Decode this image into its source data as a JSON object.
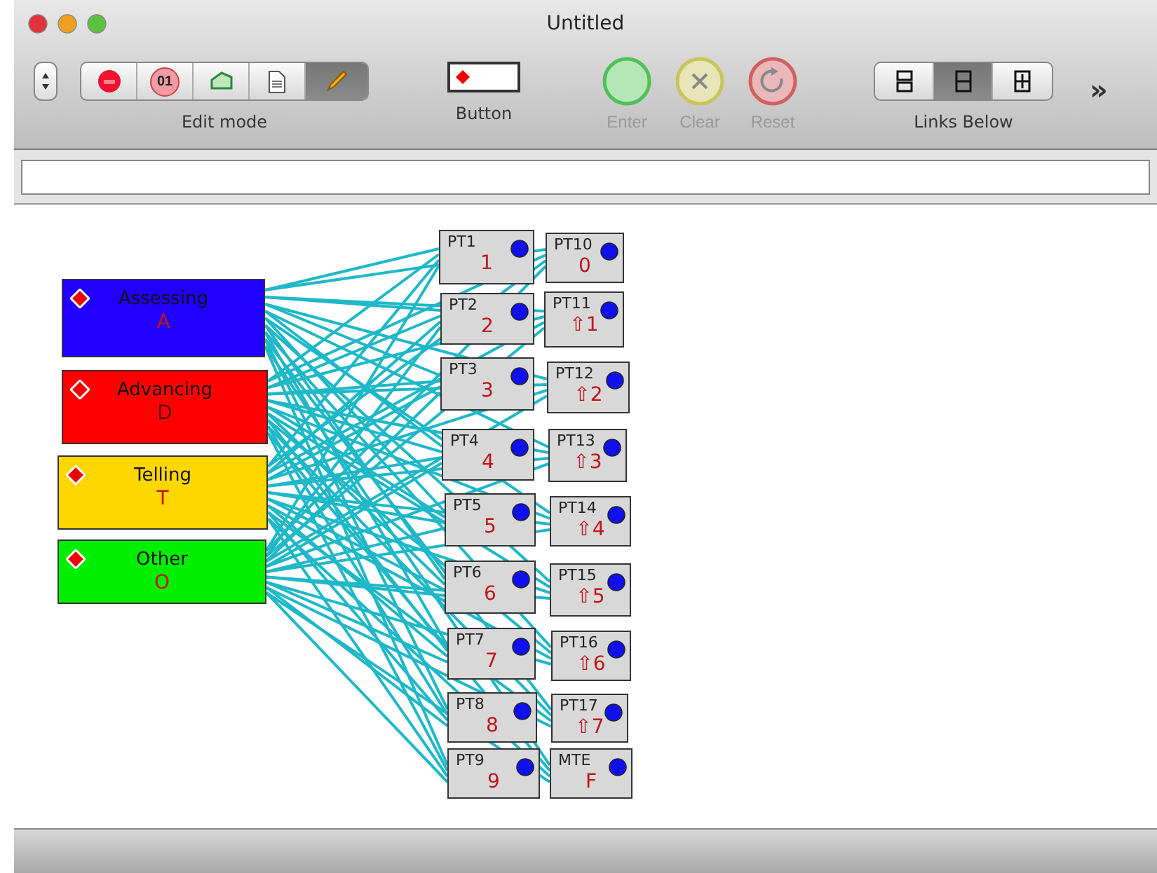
{
  "window": {
    "title": "Untitled"
  },
  "toolbar": {
    "edit_mode": {
      "label": "Edit mode",
      "segments": [
        {
          "kind": "record",
          "selected": false
        },
        {
          "kind": "counter",
          "text": "01",
          "selected": false
        },
        {
          "kind": "tag",
          "selected": false
        },
        {
          "kind": "document",
          "selected": false
        },
        {
          "kind": "pencil",
          "selected": true
        }
      ]
    },
    "button_well": {
      "label": "Button"
    },
    "actions": [
      {
        "kind": "enter",
        "label": "Enter",
        "disabled": true
      },
      {
        "kind": "clear",
        "label": "Clear",
        "disabled": true
      },
      {
        "kind": "reset",
        "label": "Reset",
        "disabled": true
      }
    ],
    "links": {
      "label": "Links Below",
      "segments": [
        {
          "kind": "separate",
          "selected": false
        },
        {
          "kind": "joined",
          "selected": true
        },
        {
          "kind": "linked",
          "selected": false
        }
      ]
    },
    "overflow": "»"
  },
  "categories": [
    {
      "label": "Assessing",
      "key": "A",
      "color": "#2200ff"
    },
    {
      "label": "Advancing",
      "key": "D",
      "color": "#ff0000"
    },
    {
      "label": "Telling",
      "key": "T",
      "color": "#ffd700"
    },
    {
      "label": "Other",
      "key": "O",
      "color": "#00ee00"
    }
  ],
  "pads": [
    {
      "label": "PT1",
      "key": "1"
    },
    {
      "label": "PT2",
      "key": "2"
    },
    {
      "label": "PT3",
      "key": "3"
    },
    {
      "label": "PT4",
      "key": "4"
    },
    {
      "label": "PT5",
      "key": "5"
    },
    {
      "label": "PT6",
      "key": "6"
    },
    {
      "label": "PT7",
      "key": "7"
    },
    {
      "label": "PT8",
      "key": "8"
    },
    {
      "label": "PT9",
      "key": "9"
    },
    {
      "label": "PT10",
      "key": "0"
    },
    {
      "label": "PT11",
      "key": "⇧1"
    },
    {
      "label": "PT12",
      "key": "⇧2"
    },
    {
      "label": "PT13",
      "key": "⇧3"
    },
    {
      "label": "PT14",
      "key": "⇧4"
    },
    {
      "label": "PT15",
      "key": "⇧5"
    },
    {
      "label": "PT16",
      "key": "⇧6"
    },
    {
      "label": "PT17",
      "key": "⇧7"
    },
    {
      "label": "MTE",
      "key": "F"
    }
  ]
}
